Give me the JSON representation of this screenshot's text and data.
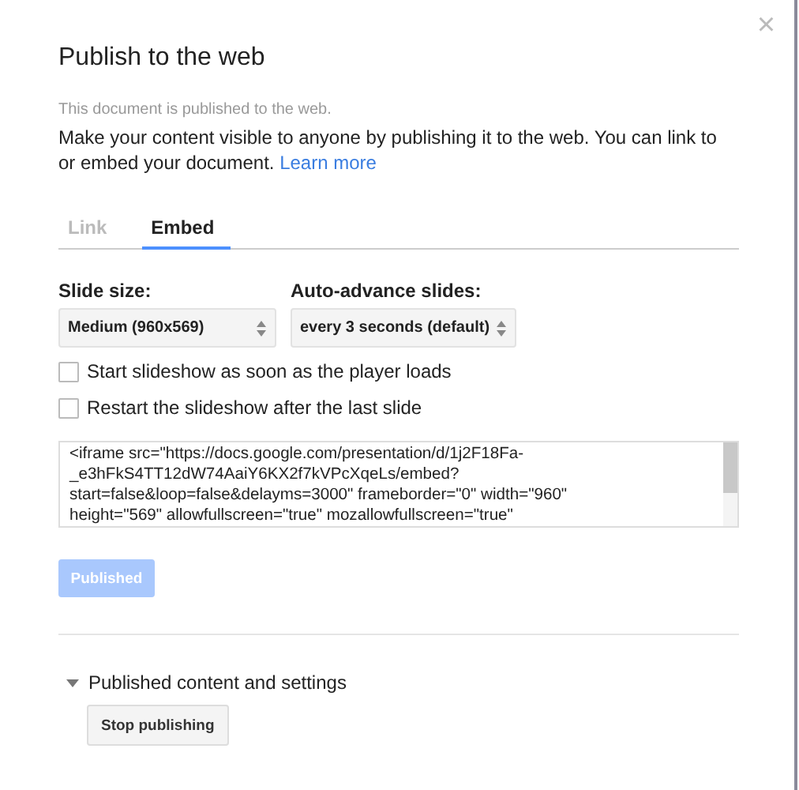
{
  "dialog": {
    "title": "Publish to the web",
    "close": "×"
  },
  "status_note": "This document is published to the web.",
  "description": "Make your content visible to anyone by publishing it to the web. You can link to or embed your document.",
  "learn_more": "Learn more",
  "tabs": [
    {
      "label": "Link",
      "selected": false
    },
    {
      "label": "Embed",
      "selected": true
    }
  ],
  "selects": [
    {
      "label": "Slide size:",
      "value": "Medium (960x569)"
    },
    {
      "label": "Auto-advance slides:",
      "value": "every 3 seconds (default)"
    }
  ],
  "options": [
    {
      "label": "Start slideshow as soon as the player loads",
      "checked": false
    },
    {
      "label": "Restart the slideshow after the last slide",
      "checked": false
    }
  ],
  "embed_code": "<iframe src=\"https://docs.google.com/presentation/d/1j2F18Fa-\n_e3hFkS4TT12dW74AaiY6KX2f7kVPcXqeLs/embed?\nstart=false&loop=false&delayms=3000\" frameborder=\"0\" width=\"960\"\nheight=\"569\" allowfullscreen=\"true\" mozallowfullscreen=\"true\"",
  "publish_button": {
    "label": "Published",
    "disabled": true
  },
  "published_section": {
    "label": "Published content and settings",
    "expanded": true,
    "stop_button": "Stop publishing"
  }
}
